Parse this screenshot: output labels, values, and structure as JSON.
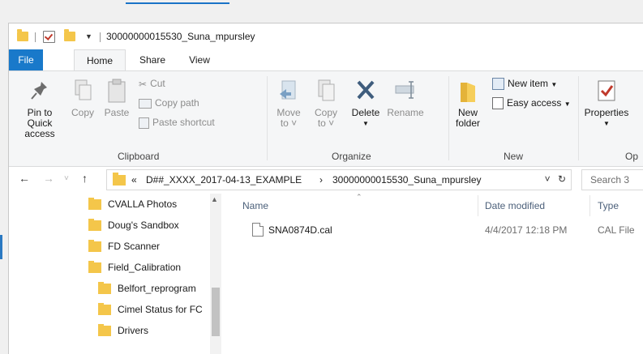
{
  "window": {
    "title": "30000000015530_Suna_mpursley"
  },
  "ribbon_tabs": {
    "file": "File",
    "home": "Home",
    "share": "Share",
    "view": "View"
  },
  "ribbon": {
    "clipboard": {
      "pin_line1": "Pin to Quick",
      "pin_line2": "access",
      "copy": "Copy",
      "paste": "Paste",
      "cut": "Cut",
      "copy_path": "Copy path",
      "paste_shortcut": "Paste shortcut",
      "label": "Clipboard"
    },
    "organize": {
      "move_line1": "Move",
      "move_line2": "to",
      "copy_line1": "Copy",
      "copy_line2": "to",
      "delete": "Delete",
      "rename": "Rename",
      "label": "Organize"
    },
    "new": {
      "new_folder_line1": "New",
      "new_folder_line2": "folder",
      "new_item": "New item",
      "easy_access": "Easy access",
      "label": "New"
    },
    "open": {
      "properties": "Properties",
      "label": "Op"
    }
  },
  "address": {
    "prefix": "«",
    "crumb1": "D##_XXXX_2017-04-13_EXAMPLE",
    "separator": "›",
    "crumb2": "30000000015530_Suna_mpursley"
  },
  "search": {
    "placeholder": "Search 3"
  },
  "nav_tree": [
    {
      "label": "CVALLA Photos"
    },
    {
      "label": "Doug's Sandbox"
    },
    {
      "label": "FD Scanner"
    },
    {
      "label": "Field_Calibration"
    },
    {
      "label": "Belfort_reprogram"
    },
    {
      "label": "Cimel Status for FC"
    },
    {
      "label": "Drivers"
    }
  ],
  "columns": {
    "name": "Name",
    "date_modified": "Date modified",
    "type": "Type"
  },
  "files": [
    {
      "name": "SNA0874D.cal",
      "date_modified": "4/4/2017 12:18 PM",
      "type": "CAL File"
    }
  ],
  "colors": {
    "accent": "#1979ca",
    "folder": "#f4c64a"
  }
}
